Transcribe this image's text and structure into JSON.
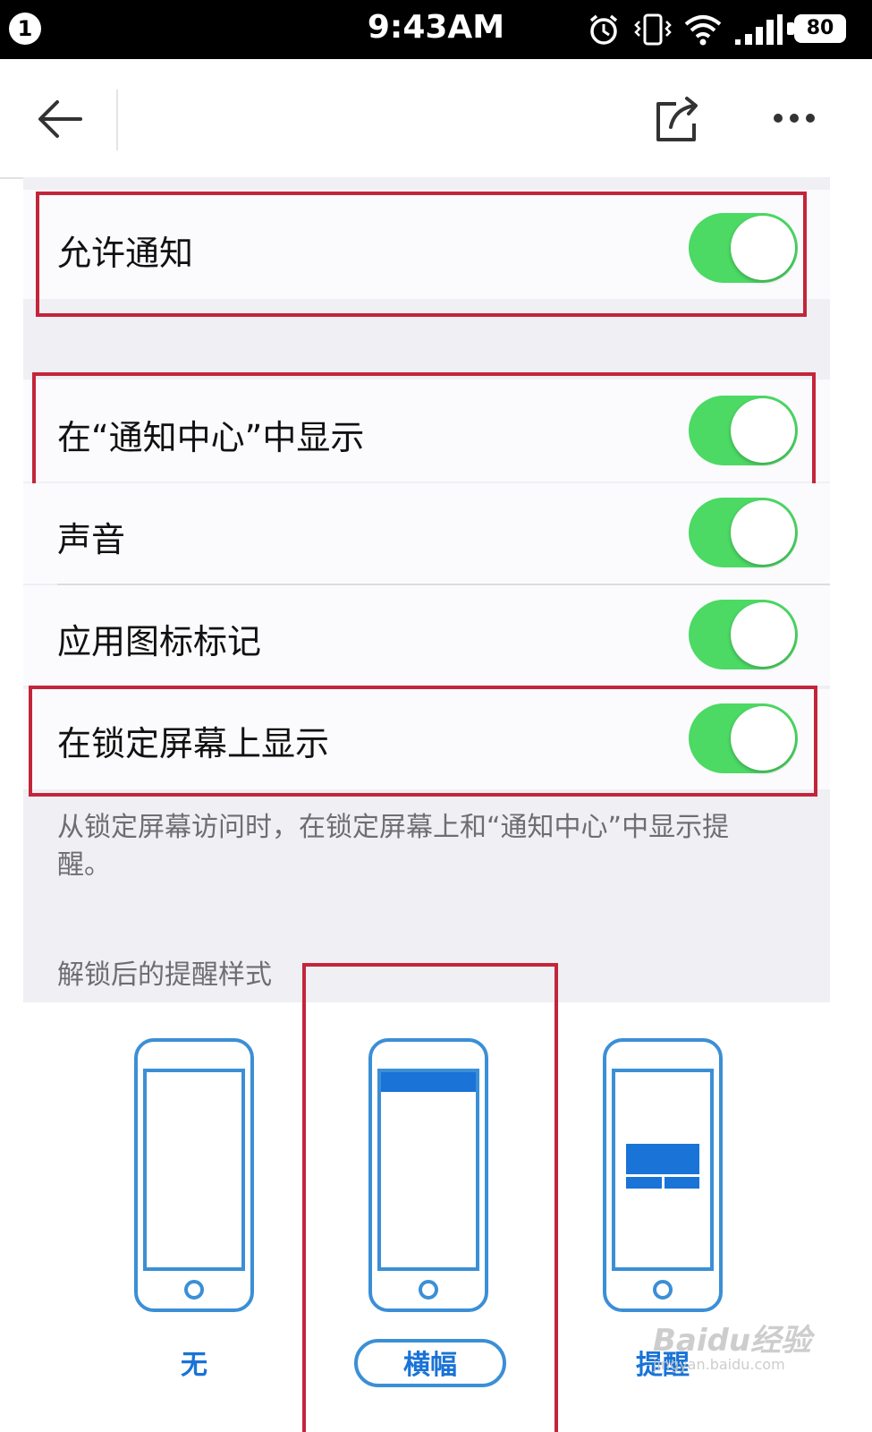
{
  "status_bar": {
    "notification_count": "1",
    "time": "9:43AM",
    "battery": "80",
    "icons": [
      "alarm-icon",
      "vibrate-icon",
      "wifi-icon",
      "signal-icon",
      "battery-icon"
    ]
  },
  "app_bar": {
    "back_icon": "arrow-left-icon",
    "share_icon": "share-icon",
    "more_icon": "more-dots-icon"
  },
  "settings": {
    "allow_notifications": {
      "label": "允许通知",
      "on": true
    },
    "show_in_notification_center": {
      "label": "在“通知中心”中显示",
      "on": true
    },
    "sounds": {
      "label": "声音",
      "on": true
    },
    "badge_app_icon": {
      "label": "应用图标标记",
      "on": true
    },
    "show_on_lock_screen": {
      "label": "在锁定屏幕上显示",
      "on": true
    },
    "lock_screen_footer": "从锁定屏幕访问时，在锁定屏幕上和“通知中心”中显示提醒。",
    "alert_style_header": "解锁后的提醒样式",
    "alert_styles": [
      {
        "label": "无",
        "selected": false
      },
      {
        "label": "横幅",
        "selected": true
      },
      {
        "label": "提醒",
        "selected": false
      }
    ]
  },
  "watermark": {
    "logo": "Baidu经验",
    "url": "jingyan.baidu.com"
  },
  "colors": {
    "toggle_on": "#4cd964",
    "highlight": "#c3253a",
    "accent_blue": "#1a73d6"
  }
}
